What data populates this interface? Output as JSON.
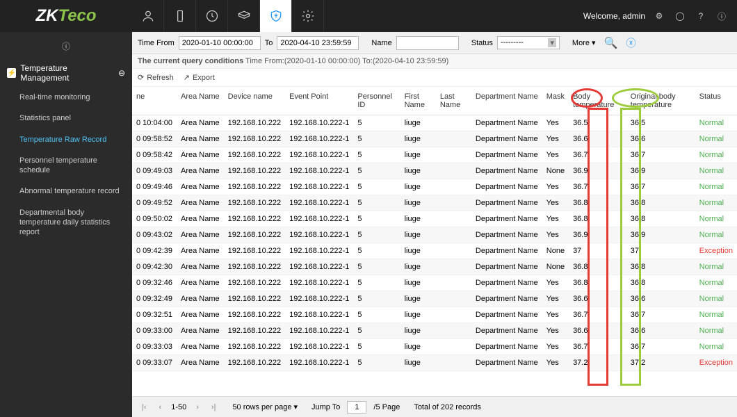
{
  "header": {
    "logo_a": "ZK",
    "logo_b": "Teco",
    "welcome": "Welcome, admin"
  },
  "sidebar": {
    "title": "Temperature Management",
    "items": [
      {
        "label": "Real-time monitoring"
      },
      {
        "label": "Statistics panel"
      },
      {
        "label": "Temperature Raw Record"
      },
      {
        "label": "Personnel temperature schedule"
      },
      {
        "label": "Abnormal temperature record"
      },
      {
        "label": "Departmental body temperature daily statistics report"
      }
    ]
  },
  "filter": {
    "time_from_label": "Time From",
    "time_from_value": "2020-01-10 00:00:00",
    "to_label": "To",
    "time_to_value": "2020-04-10 23:59:59",
    "name_label": "Name",
    "name_value": "",
    "status_label": "Status",
    "status_value": "---------",
    "more_label": "More"
  },
  "query_cond": {
    "label": "The current query conditions",
    "text": "Time From:(2020-01-10 00:00:00) To:(2020-04-10 23:59:59)"
  },
  "toolbar": {
    "refresh": "Refresh",
    "export": "Export"
  },
  "table": {
    "headers": [
      "ne",
      "Area Name",
      "Device name",
      "Event Point",
      "Personnel ID",
      "First Name",
      "Last Name",
      "Department Name",
      "Mask",
      "Body temperature",
      "Original body temperature",
      "Status"
    ],
    "rows": [
      {
        "time": "0 10:04:00",
        "area": "Area Name",
        "device": "192.168.10.222",
        "point": "192.168.10.222-1",
        "pid": "5",
        "first": "liuge",
        "last": "",
        "dept": "Department Name",
        "mask": "Yes",
        "bt": "36.5",
        "obt": "36.5",
        "status": "Normal"
      },
      {
        "time": "0 09:58:52",
        "area": "Area Name",
        "device": "192.168.10.222",
        "point": "192.168.10.222-1",
        "pid": "5",
        "first": "liuge",
        "last": "",
        "dept": "Department Name",
        "mask": "Yes",
        "bt": "36.6",
        "obt": "36.6",
        "status": "Normal"
      },
      {
        "time": "0 09:58:42",
        "area": "Area Name",
        "device": "192.168.10.222",
        "point": "192.168.10.222-1",
        "pid": "5",
        "first": "liuge",
        "last": "",
        "dept": "Department Name",
        "mask": "Yes",
        "bt": "36.7",
        "obt": "36.7",
        "status": "Normal"
      },
      {
        "time": "0 09:49:03",
        "area": "Area Name",
        "device": "192.168.10.222",
        "point": "192.168.10.222-1",
        "pid": "5",
        "first": "liuge",
        "last": "",
        "dept": "Department Name",
        "mask": "None",
        "bt": "36.9",
        "obt": "36.9",
        "status": "Normal"
      },
      {
        "time": "0 09:49:46",
        "area": "Area Name",
        "device": "192.168.10.222",
        "point": "192.168.10.222-1",
        "pid": "5",
        "first": "liuge",
        "last": "",
        "dept": "Department Name",
        "mask": "Yes",
        "bt": "36.7",
        "obt": "36.7",
        "status": "Normal"
      },
      {
        "time": "0 09:49:52",
        "area": "Area Name",
        "device": "192.168.10.222",
        "point": "192.168.10.222-1",
        "pid": "5",
        "first": "liuge",
        "last": "",
        "dept": "Department Name",
        "mask": "Yes",
        "bt": "36.8",
        "obt": "36.8",
        "status": "Normal"
      },
      {
        "time": "0 09:50:02",
        "area": "Area Name",
        "device": "192.168.10.222",
        "point": "192.168.10.222-1",
        "pid": "5",
        "first": "liuge",
        "last": "",
        "dept": "Department Name",
        "mask": "Yes",
        "bt": "36.8",
        "obt": "36.8",
        "status": "Normal"
      },
      {
        "time": "0 09:43:02",
        "area": "Area Name",
        "device": "192.168.10.222",
        "point": "192.168.10.222-1",
        "pid": "5",
        "first": "liuge",
        "last": "",
        "dept": "Department Name",
        "mask": "Yes",
        "bt": "36.9",
        "obt": "36.9",
        "status": "Normal"
      },
      {
        "time": "0 09:42:39",
        "area": "Area Name",
        "device": "192.168.10.222",
        "point": "192.168.10.222-1",
        "pid": "5",
        "first": "liuge",
        "last": "",
        "dept": "Department Name",
        "mask": "None",
        "bt": "37",
        "obt": "37",
        "status": "Exception"
      },
      {
        "time": "0 09:42:30",
        "area": "Area Name",
        "device": "192.168.10.222",
        "point": "192.168.10.222-1",
        "pid": "5",
        "first": "liuge",
        "last": "",
        "dept": "Department Name",
        "mask": "None",
        "bt": "36.8",
        "obt": "36.8",
        "status": "Normal"
      },
      {
        "time": "0 09:32:46",
        "area": "Area Name",
        "device": "192.168.10.222",
        "point": "192.168.10.222-1",
        "pid": "5",
        "first": "liuge",
        "last": "",
        "dept": "Department Name",
        "mask": "Yes",
        "bt": "36.8",
        "obt": "36.8",
        "status": "Normal"
      },
      {
        "time": "0 09:32:49",
        "area": "Area Name",
        "device": "192.168.10.222",
        "point": "192.168.10.222-1",
        "pid": "5",
        "first": "liuge",
        "last": "",
        "dept": "Department Name",
        "mask": "Yes",
        "bt": "36.6",
        "obt": "36.6",
        "status": "Normal"
      },
      {
        "time": "0 09:32:51",
        "area": "Area Name",
        "device": "192.168.10.222",
        "point": "192.168.10.222-1",
        "pid": "5",
        "first": "liuge",
        "last": "",
        "dept": "Department Name",
        "mask": "Yes",
        "bt": "36.7",
        "obt": "36.7",
        "status": "Normal"
      },
      {
        "time": "0 09:33:00",
        "area": "Area Name",
        "device": "192.168.10.222",
        "point": "192.168.10.222-1",
        "pid": "5",
        "first": "liuge",
        "last": "",
        "dept": "Department Name",
        "mask": "Yes",
        "bt": "36.6",
        "obt": "36.6",
        "status": "Normal"
      },
      {
        "time": "0 09:33:03",
        "area": "Area Name",
        "device": "192.168.10.222",
        "point": "192.168.10.222-1",
        "pid": "5",
        "first": "liuge",
        "last": "",
        "dept": "Department Name",
        "mask": "Yes",
        "bt": "36.7",
        "obt": "36.7",
        "status": "Normal"
      },
      {
        "time": "0 09:33:07",
        "area": "Area Name",
        "device": "192.168.10.222",
        "point": "192.168.10.222-1",
        "pid": "5",
        "first": "liuge",
        "last": "",
        "dept": "Department Name",
        "mask": "Yes",
        "bt": "37.2",
        "obt": "37.2",
        "status": "Exception"
      }
    ]
  },
  "footer": {
    "range": "1-50",
    "rows_per_page": "50 rows per page",
    "jump_to": "Jump To",
    "jump_value": "1",
    "pages": "/5 Page",
    "total": "Total of 202 records"
  }
}
